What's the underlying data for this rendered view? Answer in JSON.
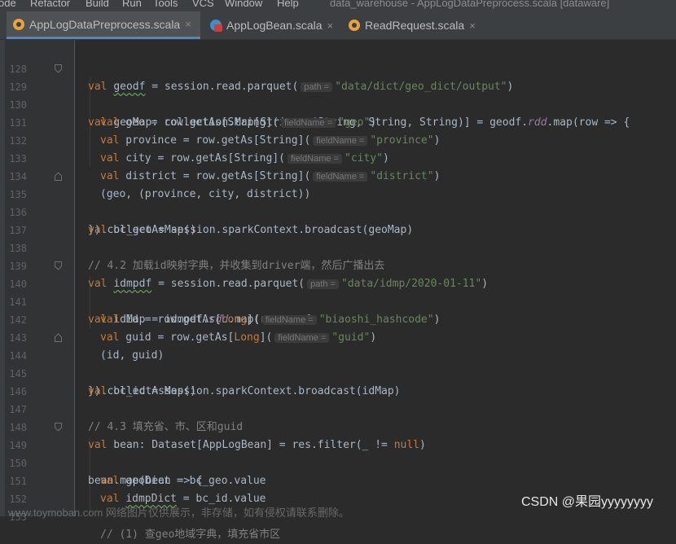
{
  "menubar": {
    "items": [
      "ode",
      "Refactor",
      "Build",
      "Run",
      "Tools",
      "VCS",
      "Window",
      "Help"
    ],
    "window_title": "data_warehouse - AppLogDataPreprocess.scala [dataware]"
  },
  "tabs": [
    {
      "label": "AppLogDataPreprocess.scala",
      "active": true,
      "icon": "scala-object-icon",
      "close": "×"
    },
    {
      "label": "AppLogBean.scala",
      "active": false,
      "icon": "scala-class-icon",
      "close": "×"
    },
    {
      "label": "ReadRequest.scala",
      "active": false,
      "icon": "scala-object-icon",
      "close": "×"
    }
  ],
  "editor": {
    "line_numbers": [
      "128",
      "129",
      "130",
      "131",
      "132",
      "133",
      "134",
      "135",
      "136",
      "137",
      "138",
      "139",
      "140",
      "141",
      "142",
      "143",
      "144",
      "145",
      "146",
      "147",
      "148",
      "149",
      "150",
      "151",
      "152",
      "153"
    ],
    "hints": {
      "path": "path =",
      "fieldName": "fieldName ="
    },
    "code": {
      "l128": {
        "kw": "val",
        "var": "geodf",
        "rest1": " = session.read.parquet(",
        "str": "\"data/dict/geo_dict/output\"",
        "rest2": ")"
      },
      "l129": {
        "kw": "val",
        "rest1": " geoMap: collection.Map[String, (String, String, String)] = geodf.",
        "fn": "rdd",
        "rest2": ".map(row => {"
      },
      "l130": {
        "kw": "val",
        "rest1": " geo = row.getAs[String](",
        "str": "\"geo\"",
        "rest2": ")"
      },
      "l131": {
        "kw": "val",
        "rest1": " province = row.getAs[String](",
        "str": "\"province\"",
        "rest2": ")"
      },
      "l132": {
        "kw": "val",
        "rest1": " city = row.getAs[String](",
        "str": "\"city\"",
        "rest2": ")"
      },
      "l133": {
        "kw": "val",
        "rest1": " district = row.getAs[String](",
        "str": "\"district\"",
        "rest2": ")"
      },
      "l134": {
        "rest1": "(geo, (province, city, district))"
      },
      "l135": {
        "rest1": "}).collectAsMap()"
      },
      "l136": {
        "kw": "val",
        "rest1": " bc_geo = session.sparkContext.broadcast(geoMap)"
      },
      "l138": {
        "cm": "// 4.2 加载id映射字典，并收集到driver端，然后广播出去"
      },
      "l139": {
        "kw": "val",
        "var": "idmpdf",
        "rest1": " = session.read.parquet(",
        "str": "\"data/idmp/2020-01-11\"",
        "rest2": ")"
      },
      "l140": {
        "kw": "val",
        "rest1": " idMap = idmpdf.",
        "fn": "rdd",
        "rest2": ".map(row => {"
      },
      "l141": {
        "kw": "val",
        "rest1": " id = row.getAs[",
        "type": "Long",
        "rest2": "](",
        "str": "\"biaoshi_hashcode\"",
        "rest3": ")"
      },
      "l142": {
        "kw": "val",
        "rest1": " guid = row.getAs[",
        "type": "Long",
        "rest2": "](",
        "str": "\"guid\"",
        "rest3": ")"
      },
      "l143": {
        "rest1": "(id, guid)"
      },
      "l144": {
        "rest1": "}).collectAsMap()"
      },
      "l145": {
        "kw": "val",
        "rest1": " bc_id = session.sparkContext.broadcast(idMap)"
      },
      "l147": {
        "cm": "// 4.3 填充省、市、区和guid"
      },
      "l148": {
        "kw": "val",
        "rest1": " bean: Dataset[AppLogBean] = res.filter(_ != ",
        "kw2": "null",
        "rest2": ")"
      },
      "l149": {
        "rest1": "bean.map(bean => {"
      },
      "l150": {
        "kw": "val",
        "rest1": " geoDict = bc_geo.value"
      },
      "l151": {
        "kw": "val",
        "var": "idmpDict",
        "rest1": " = bc_id.value"
      },
      "l153": {
        "cm": "// (1) 查geo地域字典，填充省市区"
      }
    }
  },
  "watermark": "CSDN @果园yyyyyyyy",
  "bottom_watermark": "www.toymoban.com 网络图片仅供展示，非存储，如有侵权请联系删除。",
  "colors": {
    "keyword": "#cc7832",
    "string": "#6a8759",
    "comment": "#808080",
    "field": "#9876aa",
    "accent": "#4a88c7"
  }
}
